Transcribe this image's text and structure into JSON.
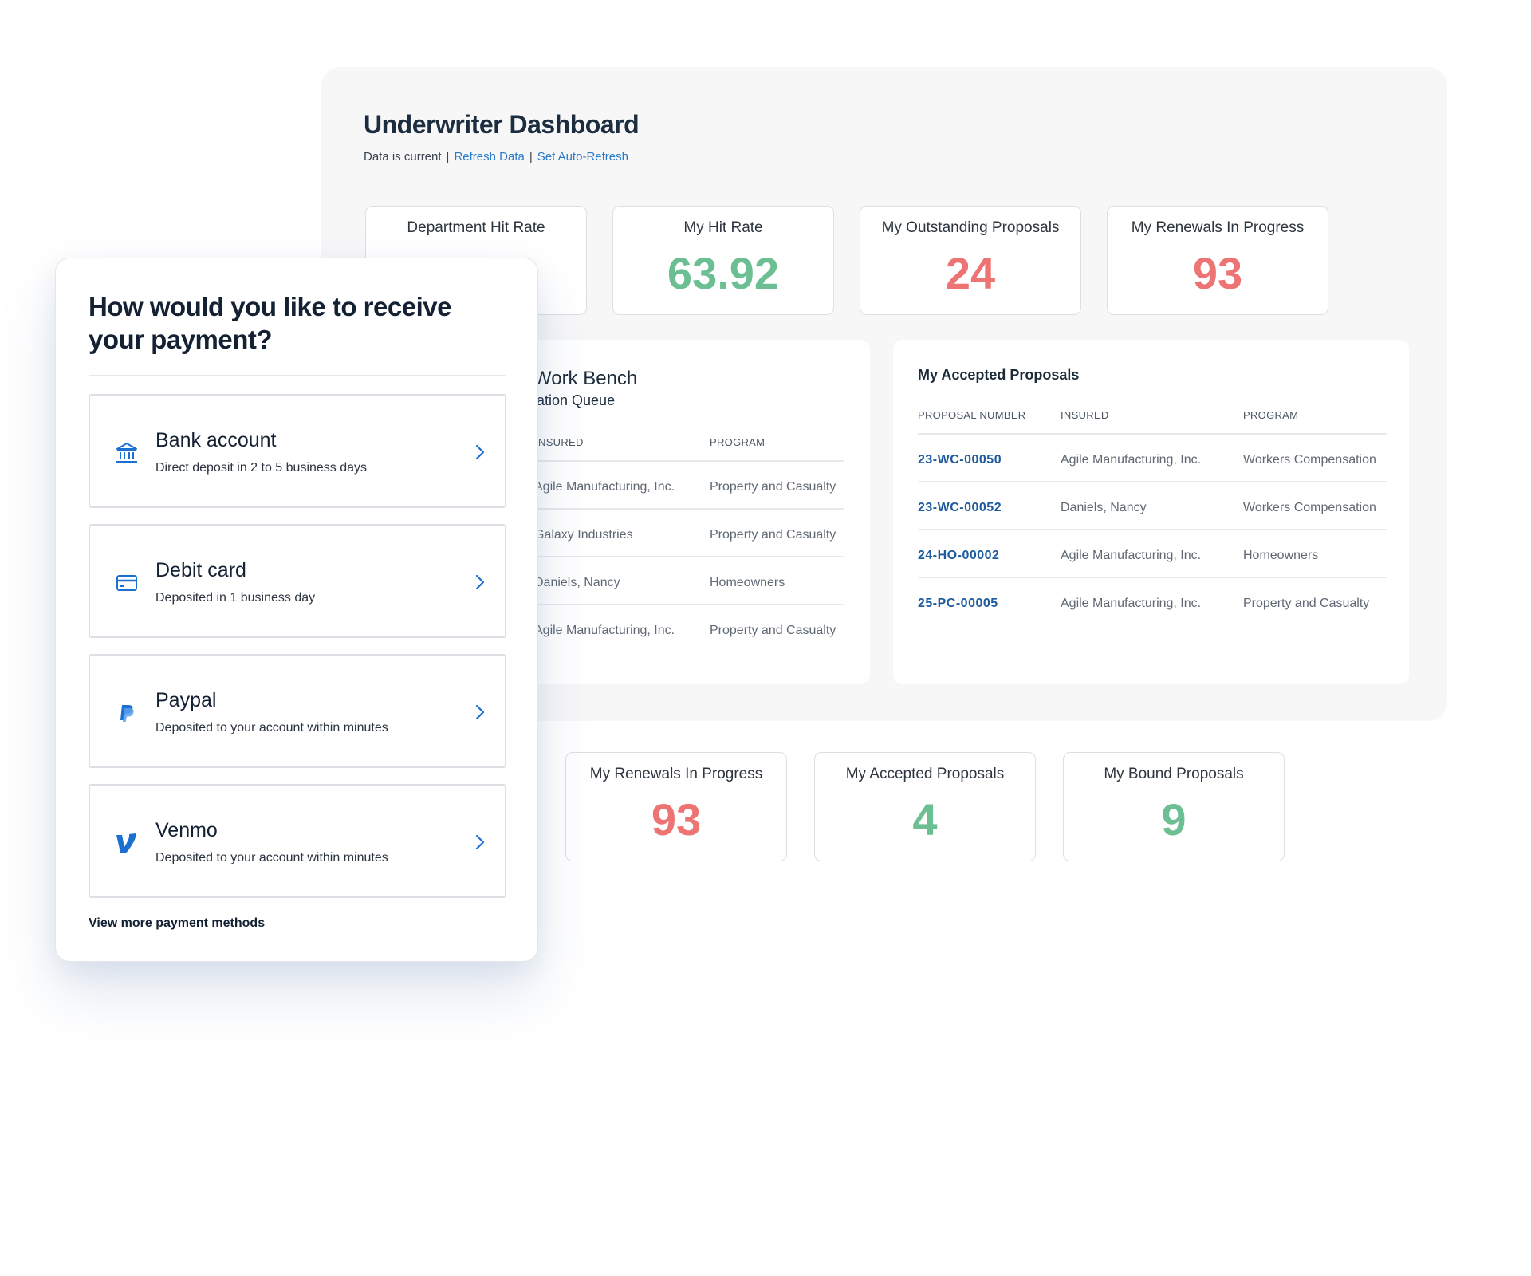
{
  "dashboard": {
    "title": "Underwriter Dashboard",
    "status_text": "Data is current",
    "separator": "|",
    "refresh_link": "Refresh Data",
    "auto_refresh_link": "Set Auto-Refresh",
    "top_stats": [
      {
        "label": "Department Hit Rate",
        "value": ""
      },
      {
        "label": "My Hit Rate",
        "value": "63.92",
        "color": "#6bbf93"
      },
      {
        "label": "My Outstanding Proposals",
        "value": "24",
        "color": "#ee7474"
      },
      {
        "label": "My Renewals In Progress",
        "value": "93",
        "color": "#ee7474"
      }
    ],
    "workbench": {
      "title": "Work Bench",
      "subtitle": "ation Queue",
      "headers": [
        "NSURED",
        "PROGRAM"
      ],
      "rows": [
        [
          "Agile Manufacturing, Inc.",
          "Property and Casualty"
        ],
        [
          "Galaxy Industries",
          "Property and Casualty"
        ],
        [
          "Daniels, Nancy",
          "Homeowners"
        ],
        [
          "Agile Manufacturing, Inc.",
          "Property and Casualty"
        ]
      ]
    },
    "accepted": {
      "title": "My Accepted Proposals",
      "headers": [
        "PROPOSAL NUMBER",
        "INSURED",
        "PROGRAM"
      ],
      "rows": [
        [
          "23-WC-00050",
          "Agile Manufacturing, Inc.",
          "Workers Compensation"
        ],
        [
          "23-WC-00052",
          "Daniels, Nancy",
          "Workers Compensation"
        ],
        [
          "24-HO-00002",
          "Agile Manufacturing, Inc.",
          "Homeowners"
        ],
        [
          "25-PC-00005",
          "Agile Manufacturing, Inc.",
          "Property and Casualty"
        ]
      ]
    },
    "bottom_stats": [
      {
        "label": "My Renewals In Progress",
        "value": "93",
        "color": "#ee7474"
      },
      {
        "label": "My Accepted Proposals",
        "value": "4",
        "color": "#6bbf93"
      },
      {
        "label": "My Bound Proposals",
        "value": "9",
        "color": "#6bbf93"
      }
    ]
  },
  "payment": {
    "title": "How would you like to receive your payment?",
    "options": [
      {
        "icon": "bank-icon",
        "name": "Bank account",
        "desc": "Direct deposit in 2 to 5 business days"
      },
      {
        "icon": "card-icon",
        "name": "Debit card",
        "desc": "Deposited in 1 business day"
      },
      {
        "icon": "paypal-icon",
        "name": "Paypal",
        "desc": "Deposited to your account within minutes"
      },
      {
        "icon": "venmo-icon",
        "name": "Venmo",
        "desc": "Deposited to your account within minutes"
      }
    ],
    "more_link": "View more payment methods",
    "accent": "#1a6fd0"
  }
}
